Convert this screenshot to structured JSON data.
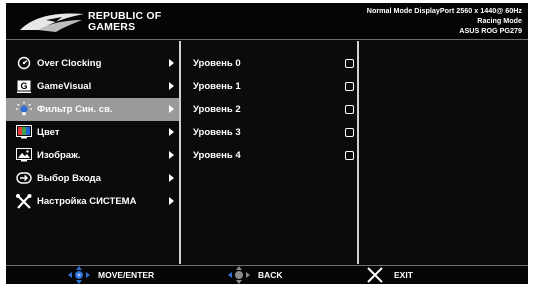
{
  "header": {
    "brand_line1": "REPUBLIC OF",
    "brand_line2": "GAMERS",
    "status_line1": "Normal Mode DisplayPort 2560 x 1440@ 60Hz",
    "status_line2": "Racing Mode",
    "status_line3": "ASUS ROG PG279"
  },
  "main_menu": {
    "items": [
      {
        "label": "Over Clocking",
        "icon": "overclock-gauge-icon"
      },
      {
        "label": "GameVisual",
        "icon": "gamevisual-g-icon"
      },
      {
        "label": "Фильтр Син. св.",
        "icon": "blue-light-bulb-icon",
        "selected": true
      },
      {
        "label": "Цвет",
        "icon": "color-icon"
      },
      {
        "label": "Изображ.",
        "icon": "image-icon"
      },
      {
        "label": "Выбор Входа",
        "icon": "input-select-icon"
      },
      {
        "label": "Настройка СИСТЕМА",
        "icon": "system-tools-icon"
      }
    ]
  },
  "submenu": {
    "items": [
      {
        "label": "Уровень 0"
      },
      {
        "label": "Уровень 1"
      },
      {
        "label": "Уровень 2"
      },
      {
        "label": "Уровень 3"
      },
      {
        "label": "Уровень 4"
      }
    ]
  },
  "footer": {
    "move_label": "MOVE/ENTER",
    "back_label": "BACK",
    "exit_label": "EXIT"
  },
  "colors": {
    "background": "#0b0b0b",
    "selected_row": "#9a9a9a",
    "divider": "#d0d0d0",
    "navigator_blue": "#2f6fd6",
    "text": "#ffffff"
  }
}
